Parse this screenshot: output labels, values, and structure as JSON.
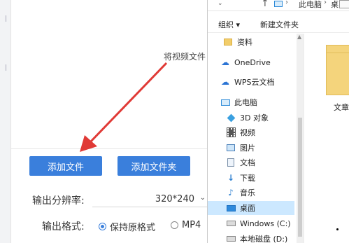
{
  "app": {
    "hint_text": "将视频文件",
    "buttons": {
      "add_file": "添加文件",
      "add_folder": "添加文件夹"
    },
    "resolution": {
      "label": "输出分辨率:",
      "value": "320*240"
    },
    "format": {
      "label": "输出格式:",
      "options": [
        "保持原格式",
        "MP4"
      ],
      "selected": "保持原格式"
    },
    "accent_color": "#3a7fdc",
    "annotation_arrow_color": "#e03a36"
  },
  "explorer": {
    "address": {
      "crumbs": [
        "此电脑",
        "桌面"
      ]
    },
    "toolbar": {
      "organize": "组织 ▾",
      "new_folder": "新建文件夹"
    },
    "nav_items": [
      {
        "label": "资料",
        "icon": "folder-icon"
      },
      {
        "label": "OneDrive",
        "icon": "cloud-icon"
      },
      {
        "label": "WPS云文档",
        "icon": "cloud-outline-icon"
      },
      {
        "label": "此电脑",
        "icon": "computer-icon"
      },
      {
        "label": "3D 对象",
        "icon": "cube-icon"
      },
      {
        "label": "视频",
        "icon": "video-icon"
      },
      {
        "label": "图片",
        "icon": "picture-icon"
      },
      {
        "label": "文档",
        "icon": "document-icon"
      },
      {
        "label": "下载",
        "icon": "download-icon"
      },
      {
        "label": "音乐",
        "icon": "music-icon"
      },
      {
        "label": "桌面",
        "icon": "desktop-icon",
        "selected": true
      },
      {
        "label": "Windows (C:)",
        "icon": "drive-icon"
      },
      {
        "label": "本地磁盘 (D:)",
        "icon": "drive-icon"
      }
    ],
    "content": {
      "folder_caption": "文章"
    }
  }
}
